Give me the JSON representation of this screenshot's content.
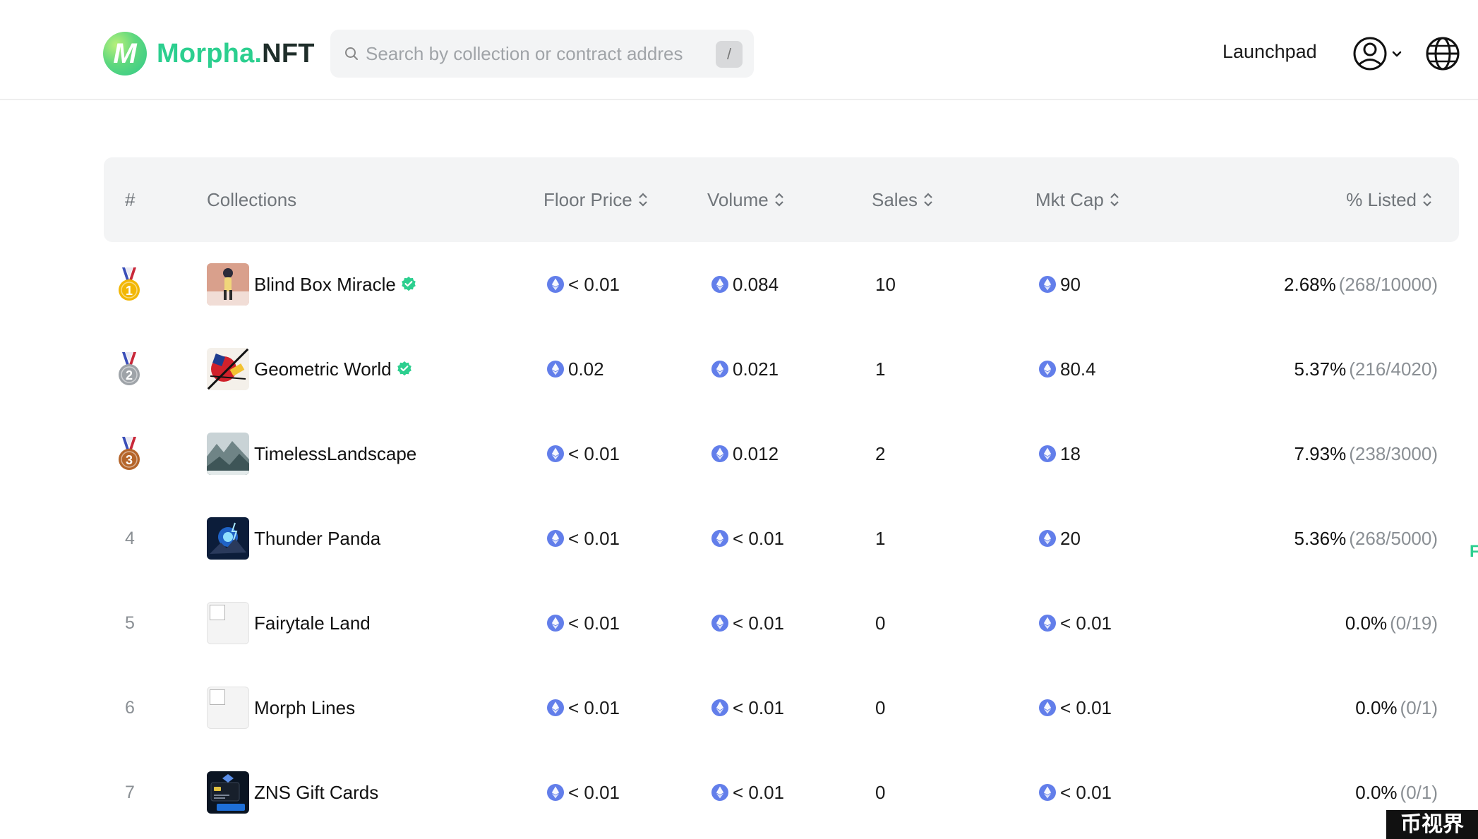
{
  "header": {
    "logo_letter": "M",
    "brand": "Morpha.",
    "brand_suffix": "NFT",
    "search_placeholder": "Search by collection or contract address",
    "search_shortcut": "/",
    "nav_launchpad": "Launchpad",
    "icons": [
      "search-icon",
      "user-icon",
      "chevron-down-icon",
      "globe-icon"
    ]
  },
  "colors": {
    "brand_green": "#2ccf8f",
    "eth_blue": "#627eea",
    "verified": "#2ccf8f",
    "gold": "#f2b705",
    "silver": "#9ea3a8",
    "bronze": "#b5652a"
  },
  "table": {
    "headers": {
      "rank": "#",
      "collections": "Collections",
      "floor_price": "Floor Price",
      "volume": "Volume",
      "sales": "Sales",
      "mkt_cap": "Mkt Cap",
      "listed": "% Listed"
    },
    "rows": [
      {
        "rank": "1",
        "medal": "gold",
        "name": "Blind Box Miracle",
        "verified": true,
        "floor": "< 0.01",
        "volume": "0.084",
        "sales": "10",
        "mkt_cap": "90",
        "listed_pct": "2.68%",
        "listed_frac": "(268/10000)"
      },
      {
        "rank": "2",
        "medal": "silver",
        "name": "Geometric World",
        "verified": true,
        "floor": "0.02",
        "volume": "0.021",
        "sales": "1",
        "mkt_cap": "80.4",
        "listed_pct": "5.37%",
        "listed_frac": "(216/4020)"
      },
      {
        "rank": "3",
        "medal": "bronze",
        "name": "TimelessLandscape",
        "verified": false,
        "floor": "< 0.01",
        "volume": "0.012",
        "sales": "2",
        "mkt_cap": "18",
        "listed_pct": "7.93%",
        "listed_frac": "(238/3000)"
      },
      {
        "rank": "4",
        "medal": "",
        "name": "Thunder Panda",
        "verified": false,
        "floor": "< 0.01",
        "volume": "< 0.01",
        "sales": "1",
        "mkt_cap": "20",
        "listed_pct": "5.36%",
        "listed_frac": "(268/5000)"
      },
      {
        "rank": "5",
        "medal": "",
        "name": "Fairytale Land",
        "verified": false,
        "floor": "< 0.01",
        "volume": "< 0.01",
        "sales": "0",
        "mkt_cap": "< 0.01",
        "listed_pct": "0.0%",
        "listed_frac": "(0/19)"
      },
      {
        "rank": "6",
        "medal": "",
        "name": "Morph Lines",
        "verified": false,
        "floor": "< 0.01",
        "volume": "< 0.01",
        "sales": "0",
        "mkt_cap": "< 0.01",
        "listed_pct": "0.0%",
        "listed_frac": "(0/1)"
      },
      {
        "rank": "7",
        "medal": "",
        "name": "ZNS Gift Cards",
        "verified": false,
        "floor": "< 0.01",
        "volume": "< 0.01",
        "sales": "0",
        "mkt_cap": "< 0.01",
        "listed_pct": "0.0%",
        "listed_frac": "(0/1)"
      }
    ]
  },
  "edge_peek": "F",
  "watermark": "币视界"
}
